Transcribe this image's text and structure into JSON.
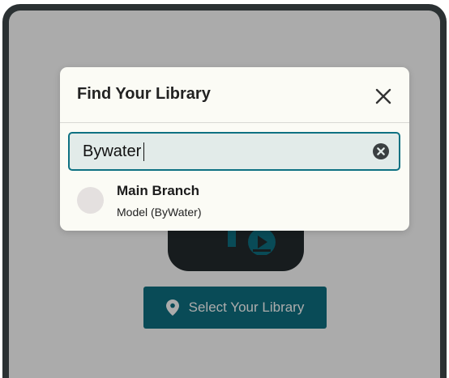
{
  "modal": {
    "title": "Find Your Library",
    "close_icon": "close-icon"
  },
  "search": {
    "value": "Bywater",
    "clear_icon": "clear-circle-icon"
  },
  "results": [
    {
      "name": "Main Branch",
      "subtitle": "Model (ByWater)"
    }
  ],
  "background": {
    "select_button_label": "Select Your Library",
    "select_button_icon": "location-pin-icon"
  },
  "colors": {
    "accent": "#0e7182",
    "overlay": "#000000",
    "modal_bg": "#fbfbf5",
    "frame": "#2b3133"
  }
}
